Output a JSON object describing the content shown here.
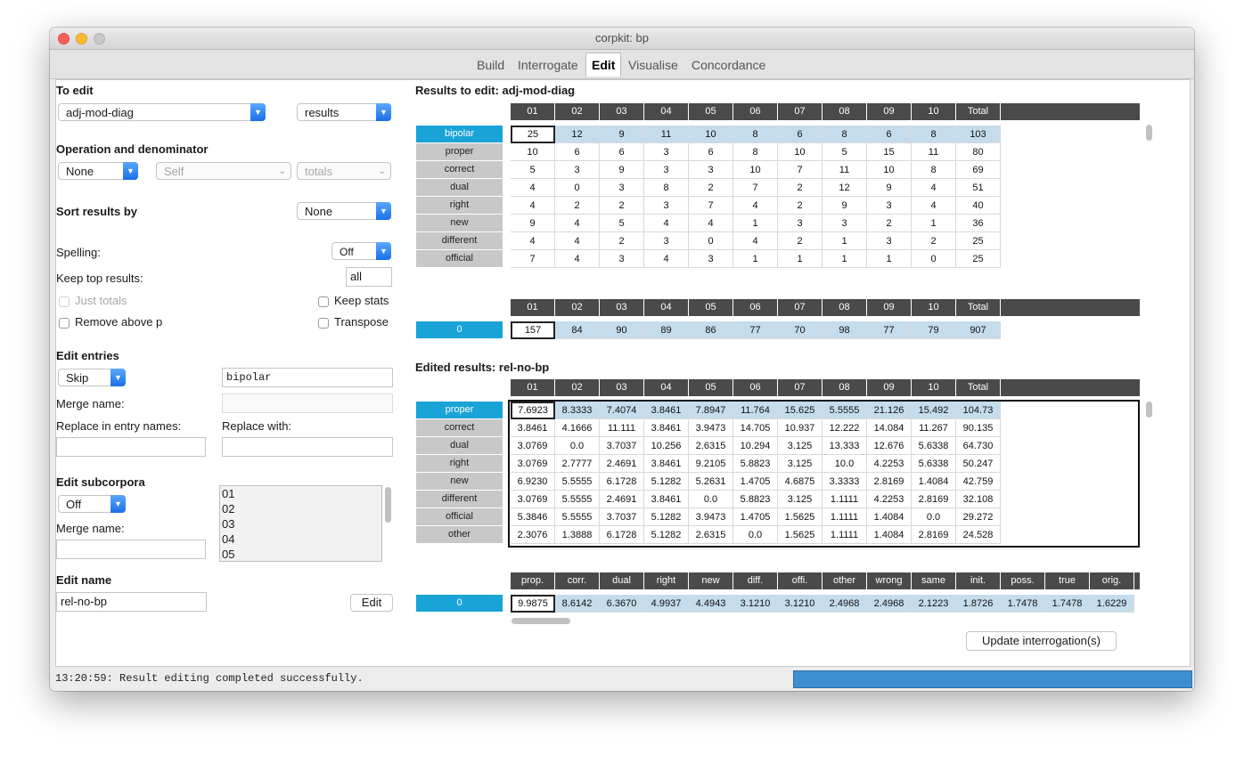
{
  "window": {
    "title": "corpkit: bp"
  },
  "tabs": [
    {
      "label": "Build"
    },
    {
      "label": "Interrogate"
    },
    {
      "label": "Edit"
    },
    {
      "label": "Visualise"
    },
    {
      "label": "Concordance"
    }
  ],
  "left": {
    "to_edit_label": "To edit",
    "to_edit_value": "adj-mod-diag",
    "to_edit_data": "results",
    "operation_label": "Operation and denominator",
    "operation_value": "None",
    "denominator_value": "Self",
    "denominator_type": "totals",
    "sort_label": "Sort results by",
    "sort_value": "None",
    "spelling_label": "Spelling:",
    "spelling_value": "Off",
    "keep_top_label": "Keep top results:",
    "keep_top_value": "all",
    "just_totals_label": "Just totals",
    "keep_stats_label": "Keep stats",
    "remove_above_p_label": "Remove above p",
    "transpose_label": "Transpose",
    "edit_entries_label": "Edit entries",
    "entries_mode": "Skip",
    "entries_value": "bipolar",
    "merge_name_label": "Merge name:",
    "replace_in_label": "Replace in entry names:",
    "replace_with_label": "Replace with:",
    "edit_subcorpora_label": "Edit subcorpora",
    "subcorpora_mode": "Off",
    "subcorpora_merge_label": "Merge name:",
    "subcorpora_list": [
      "01",
      "02",
      "03",
      "04",
      "05"
    ],
    "edit_name_label": "Edit name",
    "edit_name_value": "rel-no-bp",
    "edit_button": "Edit"
  },
  "results_to_edit": {
    "title": "Results to edit: adj-mod-diag",
    "columns": [
      "01",
      "02",
      "03",
      "04",
      "05",
      "06",
      "07",
      "08",
      "09",
      "10",
      "Total"
    ],
    "rows": [
      {
        "label": "bipolar",
        "values": [
          "25",
          "12",
          "9",
          "11",
          "10",
          "8",
          "6",
          "8",
          "6",
          "8",
          "103"
        ]
      },
      {
        "label": "proper",
        "values": [
          "10",
          "6",
          "6",
          "3",
          "6",
          "8",
          "10",
          "5",
          "15",
          "11",
          "80"
        ]
      },
      {
        "label": "correct",
        "values": [
          "5",
          "3",
          "9",
          "3",
          "3",
          "10",
          "7",
          "11",
          "10",
          "8",
          "69"
        ]
      },
      {
        "label": "dual",
        "values": [
          "4",
          "0",
          "3",
          "8",
          "2",
          "7",
          "2",
          "12",
          "9",
          "4",
          "51"
        ]
      },
      {
        "label": "right",
        "values": [
          "4",
          "2",
          "2",
          "3",
          "7",
          "4",
          "2",
          "9",
          "3",
          "4",
          "40"
        ]
      },
      {
        "label": "new",
        "values": [
          "9",
          "4",
          "5",
          "4",
          "4",
          "1",
          "3",
          "3",
          "2",
          "1",
          "36"
        ]
      },
      {
        "label": "different",
        "values": [
          "4",
          "4",
          "2",
          "3",
          "0",
          "4",
          "2",
          "1",
          "3",
          "2",
          "25"
        ]
      },
      {
        "label": "official",
        "values": [
          "7",
          "4",
          "3",
          "4",
          "3",
          "1",
          "1",
          "1",
          "1",
          "0",
          "25"
        ]
      }
    ],
    "totals_columns": [
      "01",
      "02",
      "03",
      "04",
      "05",
      "06",
      "07",
      "08",
      "09",
      "10",
      "Total"
    ],
    "totals_row": {
      "label": "0",
      "values": [
        "157",
        "84",
        "90",
        "89",
        "86",
        "77",
        "70",
        "98",
        "77",
        "79",
        "907"
      ]
    }
  },
  "edited_results": {
    "title": "Edited results: rel-no-bp",
    "columns": [
      "01",
      "02",
      "03",
      "04",
      "05",
      "06",
      "07",
      "08",
      "09",
      "10",
      "Total"
    ],
    "rows": [
      {
        "label": "proper",
        "values": [
          "7.6923",
          "8.3333",
          "7.4074",
          "3.8461",
          "7.8947",
          "11.764",
          "15.625",
          "5.5555",
          "21.126",
          "15.492",
          "104.73"
        ]
      },
      {
        "label": "correct",
        "values": [
          "3.8461",
          "4.1666",
          "11.111",
          "3.8461",
          "3.9473",
          "14.705",
          "10.937",
          "12.222",
          "14.084",
          "11.267",
          "90.135"
        ]
      },
      {
        "label": "dual",
        "values": [
          "3.0769",
          "0.0",
          "3.7037",
          "10.256",
          "2.6315",
          "10.294",
          "3.125",
          "13.333",
          "12.676",
          "5.6338",
          "64.730"
        ]
      },
      {
        "label": "right",
        "values": [
          "3.0769",
          "2.7777",
          "2.4691",
          "3.8461",
          "9.2105",
          "5.8823",
          "3.125",
          "10.0",
          "4.2253",
          "5.6338",
          "50.247"
        ]
      },
      {
        "label": "new",
        "values": [
          "6.9230",
          "5.5555",
          "6.1728",
          "5.1282",
          "5.2631",
          "1.4705",
          "4.6875",
          "3.3333",
          "2.8169",
          "1.4084",
          "42.759"
        ]
      },
      {
        "label": "different",
        "values": [
          "3.0769",
          "5.5555",
          "2.4691",
          "3.8461",
          "0.0",
          "5.8823",
          "3.125",
          "1.1111",
          "4.2253",
          "2.8169",
          "32.108"
        ]
      },
      {
        "label": "official",
        "values": [
          "5.3846",
          "5.5555",
          "3.7037",
          "5.1282",
          "3.9473",
          "1.4705",
          "1.5625",
          "1.1111",
          "1.4084",
          "0.0",
          "29.272"
        ]
      },
      {
        "label": "other",
        "values": [
          "2.3076",
          "1.3888",
          "6.1728",
          "5.1282",
          "2.6315",
          "0.0",
          "1.5625",
          "1.1111",
          "1.4084",
          "2.8169",
          "24.528"
        ]
      }
    ],
    "totals_columns": [
      "prop.",
      "corr.",
      "dual",
      "right",
      "new",
      "diff.",
      "offi.",
      "other",
      "wrong",
      "same",
      "init.",
      "poss.",
      "true",
      "orig."
    ],
    "totals_row": {
      "label": "0",
      "values": [
        "9.9875",
        "8.6142",
        "6.3670",
        "4.9937",
        "4.4943",
        "3.1210",
        "3.1210",
        "2.4968",
        "2.4968",
        "2.1223",
        "1.8726",
        "1.7478",
        "1.7478",
        "1.6229"
      ]
    }
  },
  "update_button": "Update interrogation(s)",
  "status": {
    "message": "13:20:59: Result editing completed successfully."
  }
}
